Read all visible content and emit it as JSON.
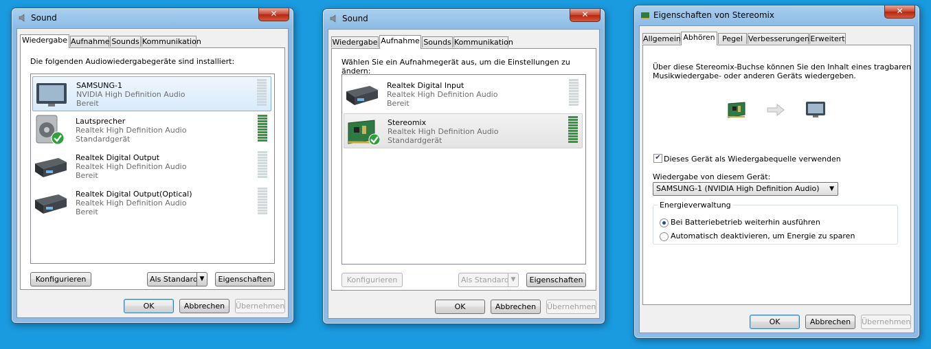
{
  "window1": {
    "title": "Sound",
    "tabs": [
      "Wiedergabe",
      "Aufnahme",
      "Sounds",
      "Kommunikation"
    ],
    "intro": "Die folgenden Audiowiedergabegeräte sind installiert:",
    "devices": [
      {
        "name": "SAMSUNG-1",
        "driver": "NVIDIA High Definition Audio",
        "status": "Bereit",
        "icon": "monitor-icon",
        "level": 0
      },
      {
        "name": "Lautsprecher",
        "driver": "Realtek High Definition Audio",
        "status": "Standardgerät",
        "icon": "speaker-icon",
        "level": 1
      },
      {
        "name": "Realtek Digital Output",
        "driver": "Realtek High Definition Audio",
        "status": "Bereit",
        "icon": "digital-output-icon",
        "level": 0
      },
      {
        "name": "Realtek Digital Output(Optical)",
        "driver": "Realtek High Definition Audio",
        "status": "Bereit",
        "icon": "digital-output-icon",
        "level": 0
      }
    ],
    "buttons": {
      "configure": "Konfigurieren",
      "set_default": "Als Standard",
      "properties": "Eigenschaften",
      "ok": "OK",
      "cancel": "Abbrechen",
      "apply": "Übernehmen"
    }
  },
  "window2": {
    "title": "Sound",
    "tabs": [
      "Wiedergabe",
      "Aufnahme",
      "Sounds",
      "Kommunikation"
    ],
    "intro": "Wählen Sie ein Aufnahmegerät aus, um die Einstellungen zu ändern:",
    "devices": [
      {
        "name": "Realtek Digital Input",
        "driver": "Realtek High Definition Audio",
        "status": "Bereit",
        "icon": "digital-input-icon",
        "level": 0
      },
      {
        "name": "Stereomix",
        "driver": "Realtek High Definition Audio",
        "status": "Standardgerät",
        "icon": "sound-card-icon",
        "level": 1
      }
    ],
    "buttons": {
      "configure": "Konfigurieren",
      "set_default": "Als Standard",
      "properties": "Eigenschaften",
      "ok": "OK",
      "cancel": "Abbrechen",
      "apply": "Übernehmen"
    }
  },
  "window3": {
    "title": "Eigenschaften von Stereomix",
    "tabs": [
      "Allgemein",
      "Abhören",
      "Pegel",
      "Verbesserungen",
      "Erweitert"
    ],
    "description": [
      "Über diese Stereomix-Buchse können Sie den Inhalt eines tragbaren",
      "Musikwiedergabe- oder anderen Geräts wiedergeben."
    ],
    "listen_checkbox": {
      "label": "Dieses Gerät als Wiedergabequelle verwenden",
      "checked": true
    },
    "playback_label": "Wiedergabe von diesem Gerät:",
    "playback_device": "SAMSUNG-1 (NVIDIA High Definition Audio)",
    "power_group": {
      "label": "Energieverwaltung",
      "options": [
        {
          "label": "Bei Batteriebetrieb weiterhin ausführen",
          "selected": true
        },
        {
          "label": "Automatisch deaktivieren, um Energie zu sparen",
          "selected": false
        }
      ]
    },
    "buttons": {
      "ok": "OK",
      "cancel": "Abbrechen",
      "apply": "Übernehmen"
    }
  },
  "colors": {
    "desktop": "#1a9be0",
    "meter_active": "#2e9a3a",
    "meter_idle": "#cfd9dc"
  }
}
